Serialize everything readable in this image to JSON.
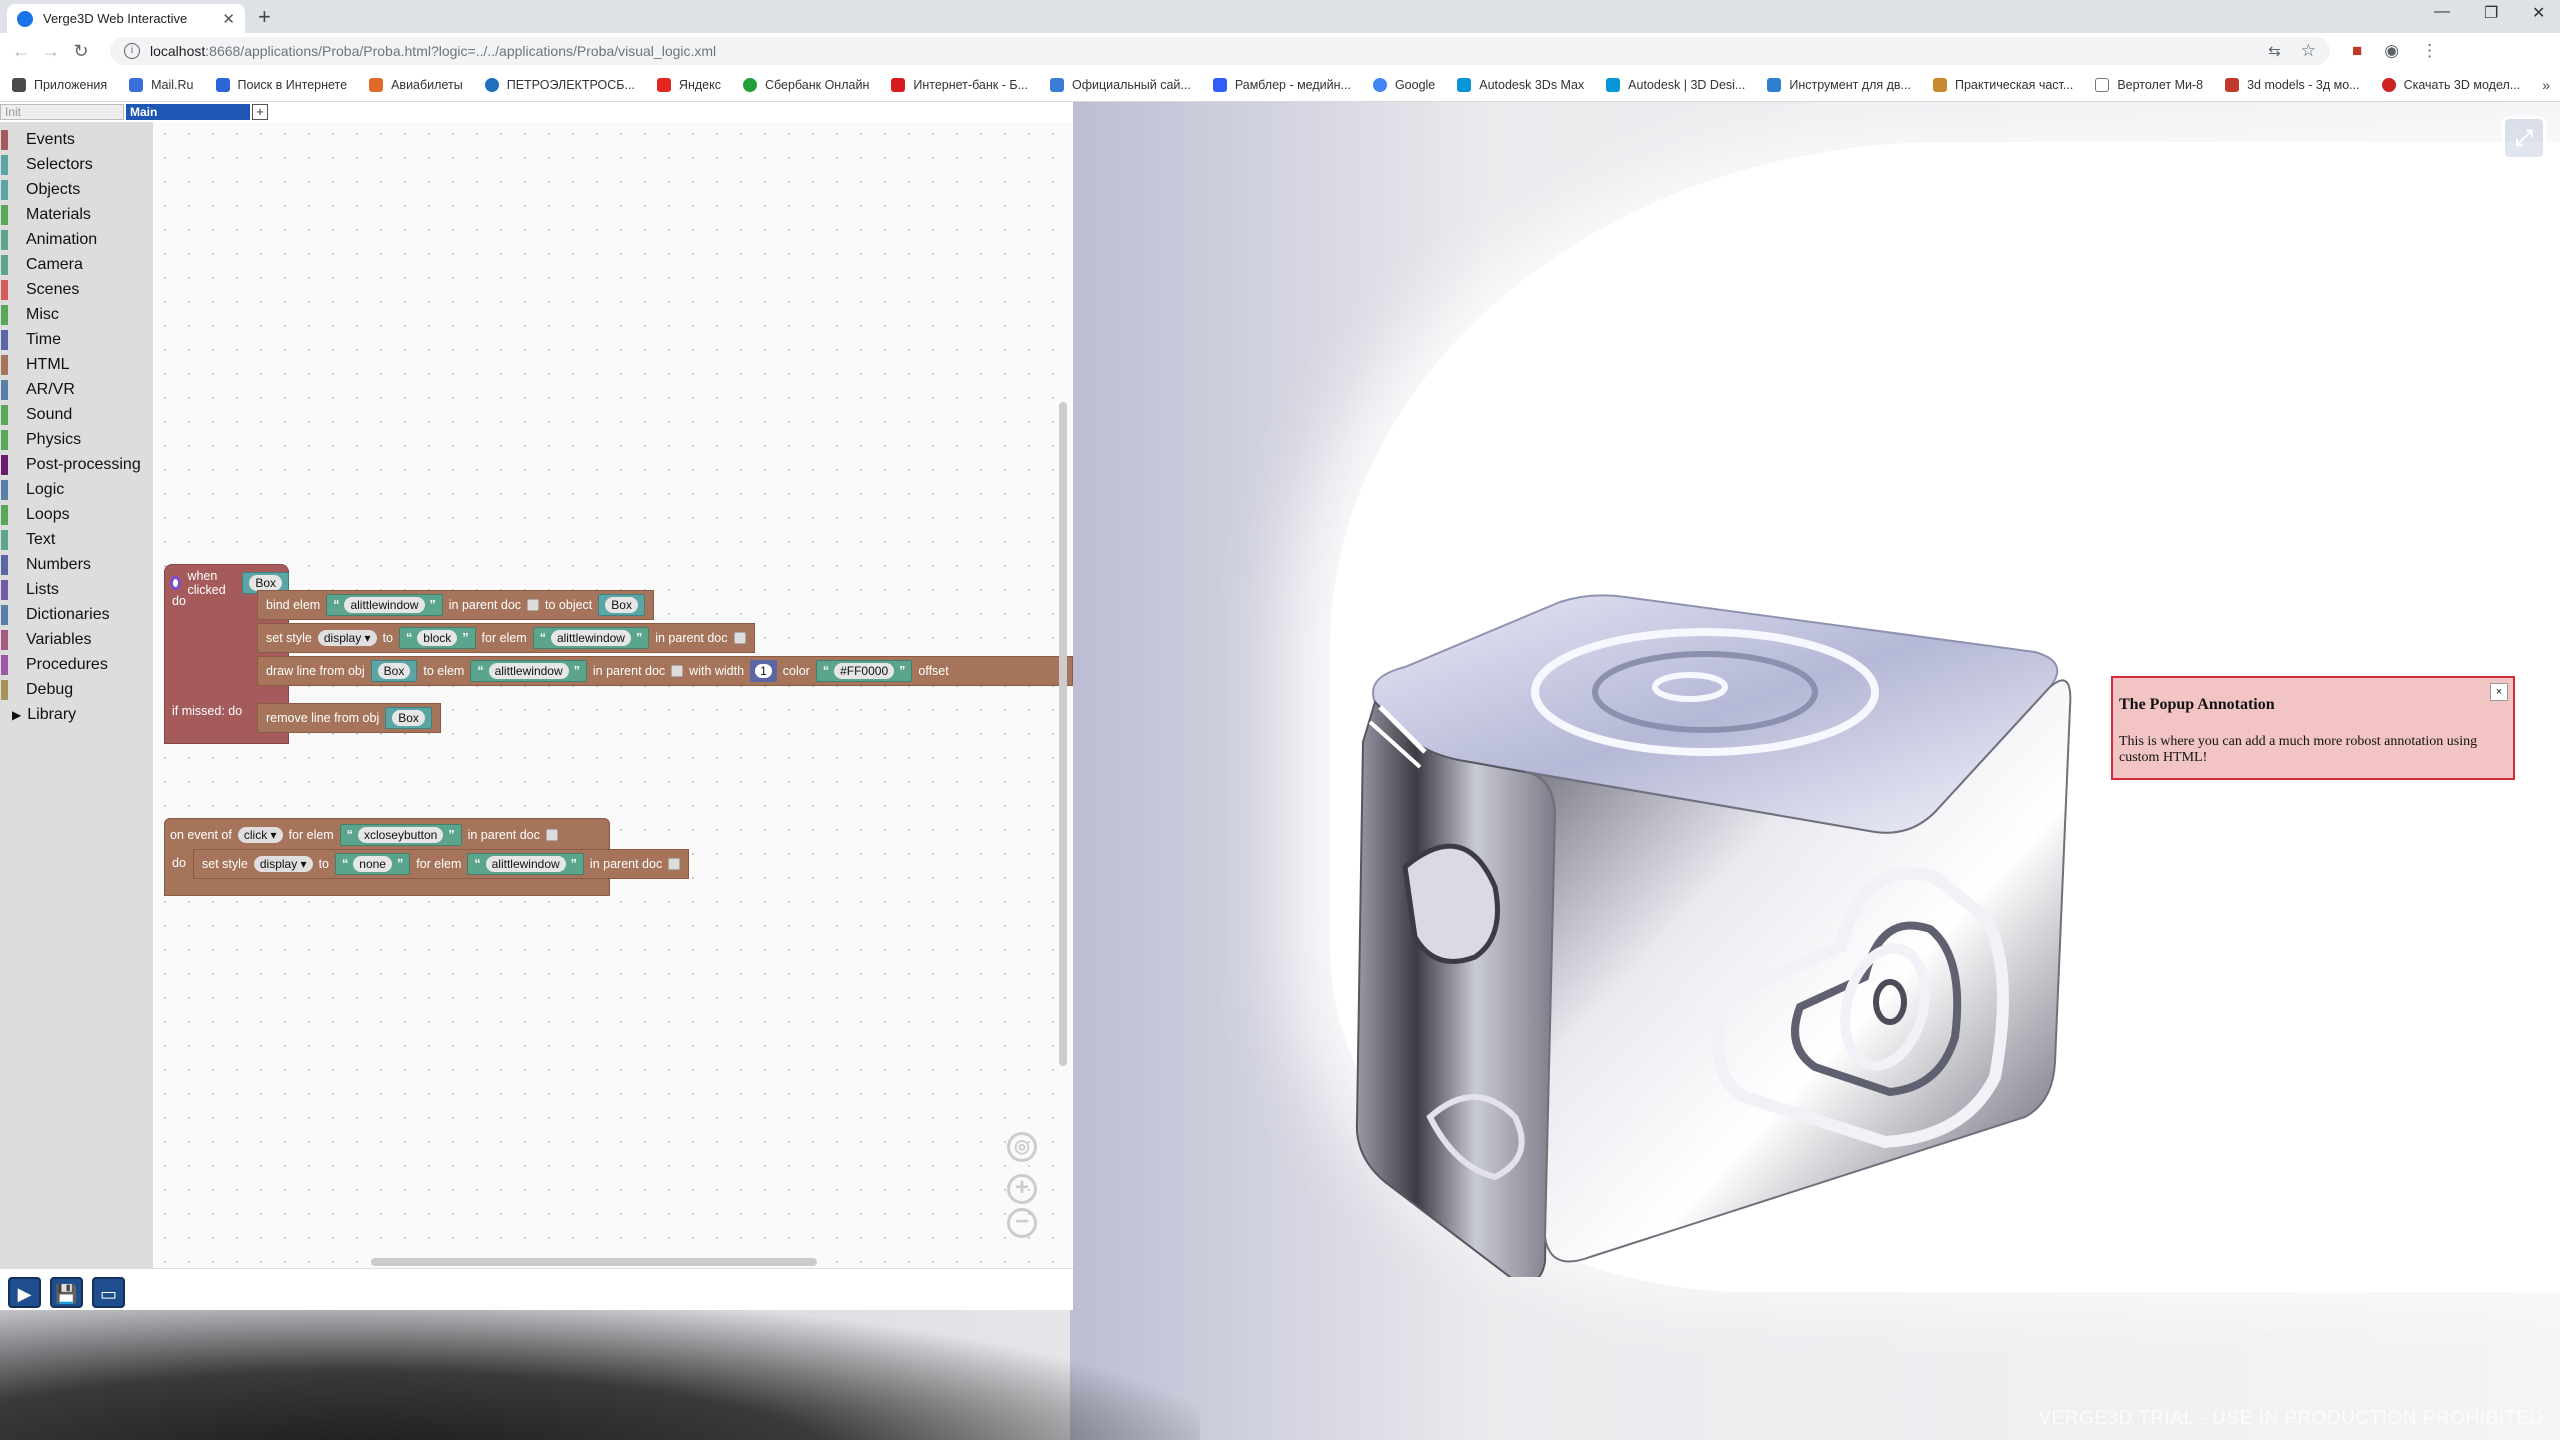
{
  "browser": {
    "tab_title": "Verge3D Web Interactive",
    "tab_close": "✕",
    "new_tab": "+",
    "url_host": "localhost",
    "url_path": ":8668/applications/Proba/Proba.html?logic=../../applications/Proba/visual_logic.xml",
    "window_controls": [
      "—",
      "❐",
      "✕"
    ],
    "bookmarks": [
      {
        "label": "Приложения",
        "color": "#4a4a4a"
      },
      {
        "label": "Mail.Ru",
        "color": "#3b6fd9"
      },
      {
        "label": "Поиск в Интернете",
        "color": "#2b65d9"
      },
      {
        "label": "Авиабилеты",
        "color": "#e06a2c"
      },
      {
        "label": "ПЕТРОЭЛЕКТРОСБ...",
        "color": "#1f6fbf"
      },
      {
        "label": "Яндекс",
        "color": "#e52620"
      },
      {
        "label": "Сбербанк Онлайн",
        "color": "#21a038"
      },
      {
        "label": "Интернет-банк - Б...",
        "color": "#d71920"
      },
      {
        "label": "Официальный сай...",
        "color": "#3a7bd5"
      },
      {
        "label": "Рамблер - медийн...",
        "color": "#315efb"
      },
      {
        "label": "Google",
        "color": "#4285f4"
      },
      {
        "label": "Autodesk 3Ds Max",
        "color": "#0696d7"
      },
      {
        "label": "Autodesk | 3D Desi...",
        "color": "#0696d7"
      },
      {
        "label": "Инструмент для дв...",
        "color": "#2d7fd0"
      },
      {
        "label": "Практическая част...",
        "color": "#c98a2e"
      },
      {
        "label": "Вертолет Ми-8",
        "color": "#777777"
      },
      {
        "label": "3d models - 3д мо...",
        "color": "#c0392b"
      },
      {
        "label": "Скачать 3D модел...",
        "color": "#cc2222"
      }
    ],
    "bookmarks_more": "»"
  },
  "editor": {
    "tabs": {
      "init": "Init",
      "main": "Main",
      "add": "+"
    },
    "categories": [
      {
        "label": "Events",
        "color": "#a55b5b"
      },
      {
        "label": "Selectors",
        "color": "#5ba5a5"
      },
      {
        "label": "Objects",
        "color": "#5ba5a5"
      },
      {
        "label": "Materials",
        "color": "#5ba55b"
      },
      {
        "label": "Animation",
        "color": "#5ba58c"
      },
      {
        "label": "Camera",
        "color": "#5ba58c"
      },
      {
        "label": "Scenes",
        "color": "#d65c5c"
      },
      {
        "label": "Misc",
        "color": "#5ba55b"
      },
      {
        "label": "Time",
        "color": "#5b67a5"
      },
      {
        "label": "HTML",
        "color": "#a5745b"
      },
      {
        "label": "AR/VR",
        "color": "#5b80a5"
      },
      {
        "label": "Sound",
        "color": "#5ba55b"
      },
      {
        "label": "Physics",
        "color": "#5ba55b"
      },
      {
        "label": "Post-processing",
        "color": "#6a1b6a"
      },
      {
        "label": "Logic",
        "color": "#5b80a5"
      },
      {
        "label": "Loops",
        "color": "#5ba55b"
      },
      {
        "label": "Text",
        "color": "#5ba58c"
      },
      {
        "label": "Numbers",
        "color": "#5b67a5"
      },
      {
        "label": "Lists",
        "color": "#745ba5"
      },
      {
        "label": "Dictionaries",
        "color": "#5b80a5"
      },
      {
        "label": "Variables",
        "color": "#a55b80"
      },
      {
        "label": "Procedures",
        "color": "#995ba5"
      },
      {
        "label": "Debug",
        "color": "#a5935b"
      }
    ],
    "library_label": "Library",
    "block1": {
      "when_clicked": "when clicked",
      "obj": "Box",
      "do": "do",
      "bind_elem": "bind elem",
      "in_parent_doc": "in parent doc",
      "to_object": "to object",
      "elem_name": "alittlewindow",
      "set_style": "set style",
      "prop_display": "display",
      "to": "to",
      "val_block": "block",
      "for_elem": "for elem",
      "draw_line": "draw line from obj",
      "to_elem": "to elem",
      "with_width": "with width",
      "width_val": "1",
      "color_label": "color",
      "color_val": "#FF0000",
      "offset": "offset",
      "if_missed": "if missed:",
      "remove_line": "remove line from obj"
    },
    "block2": {
      "on_event": "on event of",
      "event": "click",
      "for_elem": "for elem",
      "elem": "xcloseybutton",
      "in_parent_doc": "in parent doc",
      "do": "do",
      "set_style": "set style",
      "prop": "display",
      "to": "to",
      "val_none": "none",
      "elem2": "alittlewindow"
    },
    "buttons": {
      "run": "▶",
      "save": "💾",
      "menu": "▭"
    }
  },
  "scene": {
    "popup_title": "The Popup Annotation",
    "popup_text": "This is where you can add a much more robost annotation using custom HTML!",
    "popup_close": "×",
    "watermark": "VERGE3D TRIAL - USE IN PRODUCTION PROHIBITED",
    "fullscreen_icon": "⤢"
  }
}
